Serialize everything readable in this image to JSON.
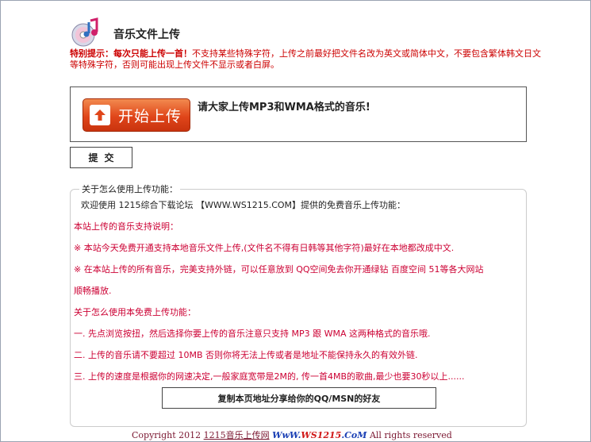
{
  "header": {
    "title": "音乐文件上传",
    "logo_icon": "music-cd-icon"
  },
  "notice": {
    "prefix": "特别提示：每次只能上传一首！",
    "text": "不支持某些特殊字符，上传之前最好把文件名改为英文或简体中文，不要包含繁体韩文日文等特殊字符，否则可能出现上传文件不显示或者白屏。"
  },
  "upload": {
    "button_label": "开始上传",
    "hint": "请大家上传MP3和WMA格式的音乐!"
  },
  "submit_label": "提交",
  "info": {
    "legend": "关于怎么使用上传功能：",
    "lines": [
      "欢迎使用 1215综合下载论坛 【WWW.WS1215.COM】提供的免费音乐上传功能：",
      "本站上传的音乐支持说明：",
      "※ 本站今天免费开通支持本地音乐文件上传,(文件名不得有日韩等其他字符)最好在本地都改成中文.",
      "※ 在本站上传的所有音乐，完美支持外链，可以任意放到 QQ空间免去你开通绿钻 百度空间 51等各大网站",
      "顺畅播放.",
      "关于怎么使用本免费上传功能：",
      "一. 先点浏览按扭，然后选择你要上传的音乐注意只支持 MP3 跟 WMA 这两种格式的音乐哦.",
      "二. 上传的音乐请不要超过 10MB 否则你将无法上传或者是地址不能保持永久的有效外链.",
      "三. 上传的速度是根据你的网速决定,一般家庭宽带是2M的, 传一首4MB的歌曲,最少也要30秒以上......"
    ]
  },
  "share_label": "复制本页地址分享给你的QQ/MSN的好友",
  "footer": {
    "copyright": "Copyright 2012",
    "link": "1215音乐上传网",
    "site_prefix": "WwW.",
    "site_num": "WS1215",
    "site_suffix": ".CoM",
    "rights": "All rights reserved"
  }
}
